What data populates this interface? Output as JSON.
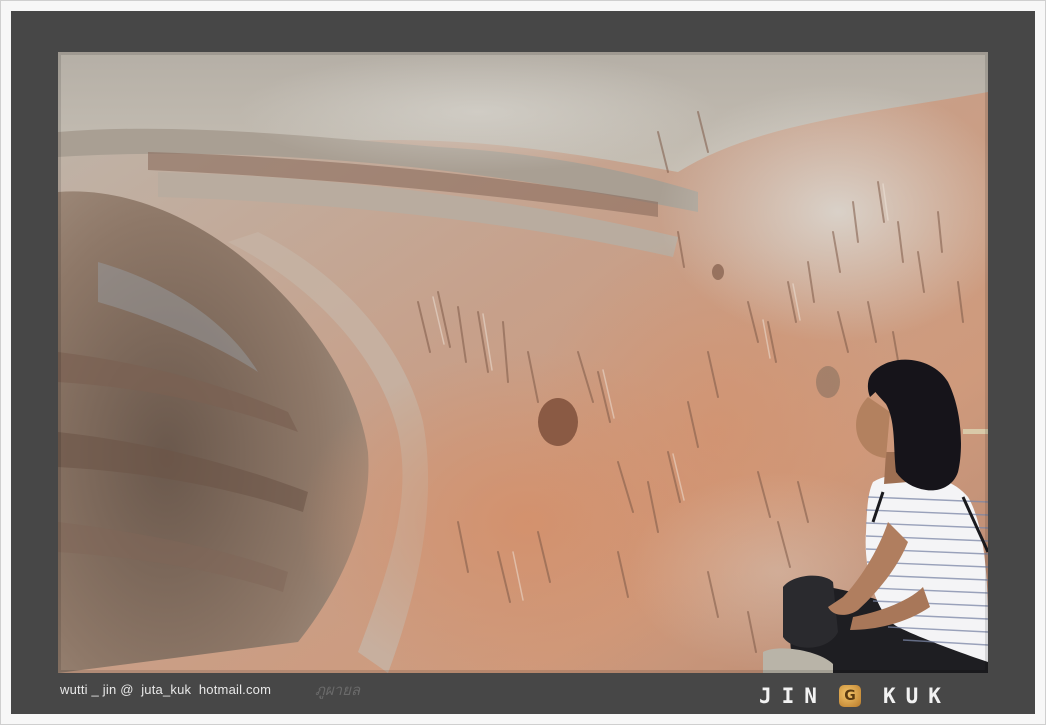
{
  "photo": {
    "subject": "woman viewing prehistoric rock engravings on sandstone cliff wall"
  },
  "caption": {
    "text": "wutti _ jin @  juta_kuk  hotmail.com"
  },
  "location_mark": {
    "text": "ภูผายล"
  },
  "logo": {
    "left_word": "JIN",
    "right_word": "KUK",
    "badge_glyph": "G"
  },
  "colors": {
    "frame": "#474747",
    "border": "#f7f7f7",
    "rock_warm": "#c98f6e",
    "rock_pale": "#c9c4bc"
  }
}
